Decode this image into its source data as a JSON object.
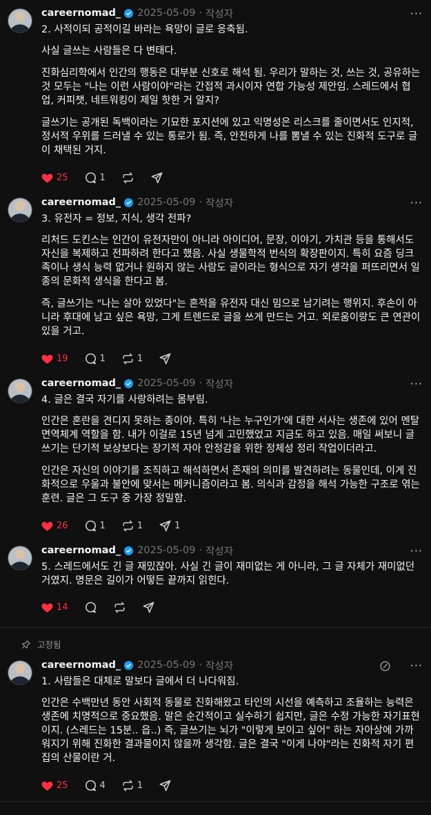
{
  "author": {
    "username": "careernomad_",
    "date": "2025-05-09",
    "sep": "·",
    "tag": "작성자",
    "more": "···"
  },
  "pinned_label": "고정됨",
  "colors": {
    "like": "#ff3040",
    "verified": "#1d9bf0",
    "background": "#101010"
  },
  "posts": [
    {
      "paragraphs": [
        "2. 사적이되 공적이길 바라는 욕망이 글로 응축됨.",
        "사실 글쓰는 사람들은 다 변태다.",
        "진화심리학에서 인간의 행동은 대부분 신호로 해석 됨. 우리가 말하는 것, 쓰는 것, 공유하는 것 모두는 \"나는 이런 사람이야\"라는 간접적 과시이자 연합 가능성 제안임. 스레드에서 협업, 커피챗, 네트워킹이 제일 핫한 거 알지?",
        "글쓰기는 공개된 독백이라는 기묘한 포지션에 있고 익명성은 리스크를 줄이면서도 인지적, 정서적 우위를 드러낼 수 있는 통로가 됨. 즉, 안전하게 나를 뽐낼 수 있는 진화적 도구로 글이 채택된 거지."
      ],
      "likes": "25",
      "replies": "1",
      "reposts": "",
      "shares": ""
    },
    {
      "paragraphs": [
        "3. 유전자 = 정보, 지식, 생각 전파?",
        "리처드 도킨스는 인간이 유전자만이 아니라 아이디어, 문장, 이야기, 가치관 등을 통해서도 자신을 복제하고 전파하려 한다고 했음. 사실 생물학적 번식의 확장판이지. 특히 요즘 딩크족이나 생식 능력 없거나 원하지 않는 사람도 글이라는 형식으로 자기 생각을 퍼뜨리면서 일종의 문화적 생식을 한다고 봄.",
        "즉, 글쓰기는 \"나는 살아 있었다\"는 흔적을 유전자 대신 밈으로 남기려는 행위지. 후손이 아니라 후대에 남고 싶은 욕망, 그게 트렌드로 글을 쓰게 만드는 거고. 외로움이랑도 큰 연관이 있을 거고."
      ],
      "likes": "19",
      "replies": "1",
      "reposts": "1",
      "shares": ""
    },
    {
      "paragraphs": [
        "4. 글은 결국 자기를 사랑하려는 몸부림.",
        "인간은 혼란을 견디지 못하는 종이야. 특히 '나는 누구인가'에 대한 서사는 생존에 있어 멘탈 면역체계 역할을 함. 내가 이걸로 15년 넘게 고민했었고 지금도 하고 있음. 매일 써보니 글쓰기는 단기적 보상보다는 장기적 자아 안정감을 위한 정체성 정리 작업이더라고.",
        "인간은 자신의 이야기를 조직하고 해석하면서 존재의 의미를 발견하려는 동물인데, 이게 진화적으로 우울과 불안에 맞서는 메커니즘이라고 봄. 의식과 감정을 해석 가능한 구조로 엮는 훈련. 글은 그 도구 중 가장 정밀함."
      ],
      "likes": "26",
      "replies": "1",
      "reposts": "1",
      "shares": "1"
    },
    {
      "paragraphs": [
        "5. 스레드에서도 긴 글 재밌잖아. 사실 긴 글이 재미없는 게 아니라, 그 글 자체가 재미없던 거였지. 명문은 길이가 어떻든 끝까지 읽힌다."
      ],
      "likes": "14",
      "replies": "",
      "reposts": "",
      "shares": ""
    },
    {
      "paragraphs": [
        "1. 사람들은 대체로 말보다 글에서 더 나다워짐.",
        "인간은 수백만년 동안 사회적 동물로 진화해왔고 타인의 시선을 예측하고 조율하는 능력은 생존에 치명적으로 중요했음. 말은 순간적이고 실수하기 쉽지만, 글은 수정 가능한 자기표현이지. (스레드는 15분.. 읍..) 즉, 글쓰기는 뇌가 \"이렇게 보이고 싶어\" 하는 자아상에 가까워지기 위해 진화한 결과물이지 않을까 생각함. 글은 결국 \"이게 나야\"라는 진화적 자기 편집의 산물이란 거."
      ],
      "likes": "25",
      "replies": "4",
      "reposts": "1",
      "shares": ""
    }
  ]
}
